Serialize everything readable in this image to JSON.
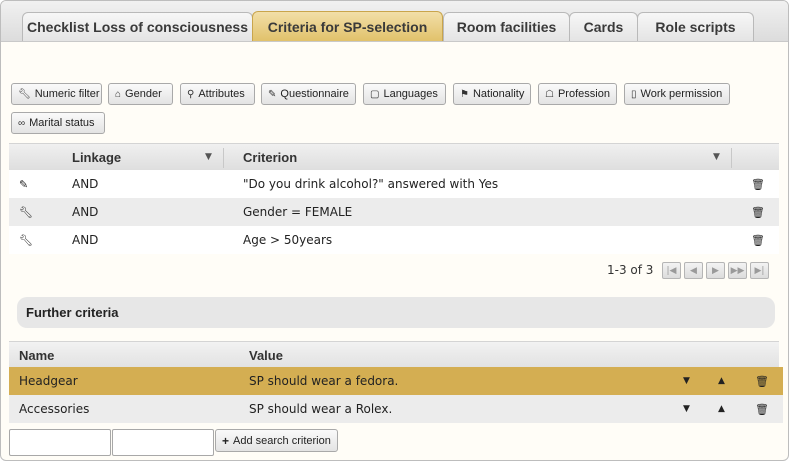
{
  "tabs": [
    {
      "label": "Checklist Loss of consciousness",
      "active": false
    },
    {
      "label": "Criteria for SP-selection",
      "active": true
    },
    {
      "label": "Room facilities",
      "active": false
    },
    {
      "label": "Cards",
      "active": false
    },
    {
      "label": "Role scripts",
      "active": false
    }
  ],
  "toolbar": {
    "numeric_filter": "Numeric filter",
    "gender": "Gender",
    "attributes": "Attributes",
    "questionnaire": "Questionnaire",
    "languages": "Languages",
    "nationality": "Nationality",
    "profession": "Profession",
    "work_permission": "Work permission",
    "marital_status": "Marital status"
  },
  "criteria_table": {
    "columns": {
      "linkage": "Linkage",
      "criterion": "Criterion"
    },
    "rows": [
      {
        "icon": "pencil-icon",
        "linkage": "AND",
        "criterion": "\"Do you drink alcohol?\" answered with Yes"
      },
      {
        "icon": "wrench-icon",
        "linkage": "AND",
        "criterion": "Gender = FEMALE"
      },
      {
        "icon": "wrench-icon",
        "linkage": "AND",
        "criterion": "Age > 50years"
      }
    ],
    "pager": {
      "text": "1-3 of 3"
    }
  },
  "further_criteria": {
    "title": "Further criteria",
    "columns": {
      "name": "Name",
      "value": "Value"
    },
    "rows": [
      {
        "name": "Headgear",
        "value": "SP should wear a fedora.",
        "selected": true
      },
      {
        "name": "Accessories",
        "value": "SP should wear a Rolex.",
        "selected": false
      }
    ]
  },
  "add_form": {
    "name_value": "",
    "value_value": "",
    "add_label": "Add search criterion"
  },
  "colors": {
    "accent": "#d4ae52",
    "tab_active": "#e1c26b",
    "background": "#fffdf7"
  }
}
